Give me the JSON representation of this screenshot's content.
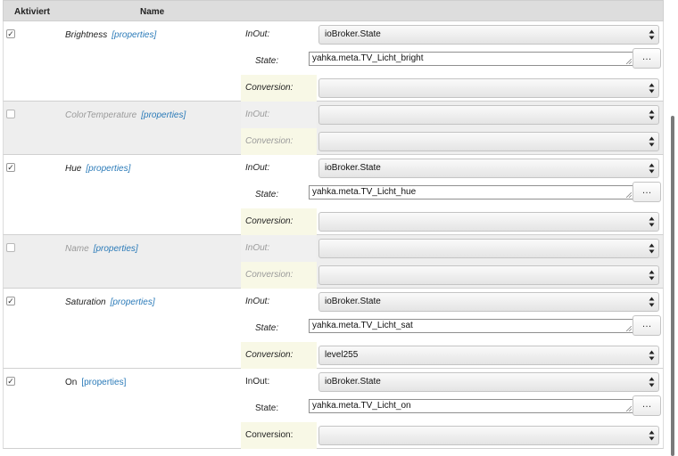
{
  "header": {
    "aktiviert": "Aktiviert",
    "name": "Name"
  },
  "props_label": "[properties]",
  "labels": {
    "inout": "InOut:",
    "state": "State:",
    "conversion": "Conversion:",
    "dots": "…"
  },
  "rows": [
    {
      "name": "Brightness",
      "enabled": true,
      "inout": "ioBroker.State",
      "state": "yahka.meta.TV_Licht_bright",
      "conversion": ""
    },
    {
      "name": "ColorTemperature",
      "enabled": false,
      "inout": "",
      "conversion": ""
    },
    {
      "name": "Hue",
      "enabled": true,
      "inout": "ioBroker.State",
      "state": "yahka.meta.TV_Licht_hue",
      "conversion": ""
    },
    {
      "name": "Name",
      "enabled": false,
      "inout": "",
      "conversion": ""
    },
    {
      "name": "Saturation",
      "enabled": true,
      "inout": "ioBroker.State",
      "state": "yahka.meta.TV_Licht_sat",
      "conversion": "level255"
    },
    {
      "name": "On",
      "enabled": true,
      "inout": "ioBroker.State",
      "state": "yahka.meta.TV_Licht_on",
      "conversion": ""
    }
  ]
}
